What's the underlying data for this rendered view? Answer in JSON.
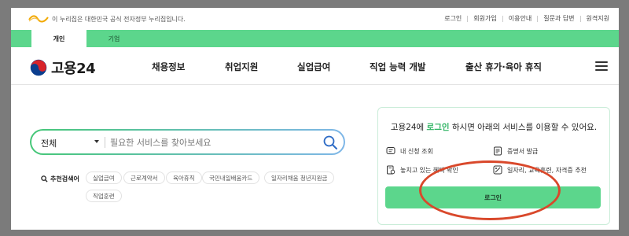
{
  "gov_banner": {
    "text": "이 누리집은 대한민국 공식 전자정부 누리집입니다.",
    "links": [
      "로그인",
      "회원가입",
      "이용안내",
      "질문과 답변",
      "원격지원"
    ]
  },
  "tabs": [
    {
      "label": "개인",
      "active": true
    },
    {
      "label": "기업",
      "active": false
    }
  ],
  "header": {
    "logo_text": "고용24",
    "nav": [
      "채용정보",
      "취업지원",
      "실업급여",
      "직업 능력 개발",
      "출산 휴가·육아 휴직"
    ]
  },
  "search": {
    "scope": "전체",
    "placeholder": "필요한 서비스를 찾아보세요",
    "keywords_label": "추천검색어",
    "keywords": [
      "실업급여",
      "근로계약서",
      "육아휴직",
      "국민내일배움카드",
      "일자리채움 청년지원금",
      "직업훈련"
    ]
  },
  "login_card": {
    "title_prefix": "고용24에 ",
    "title_highlight": "로그인",
    "title_suffix": " 하시면 아래의 서비스를 이용할 수 있어요.",
    "services": [
      "내 신청 조회",
      "증명서 발급",
      "놓치고 있는 혜택 확인",
      "일자리, 교육훈련, 자격증 추천"
    ],
    "button_label": "로그인"
  },
  "colors": {
    "brand_green": "#5cd68c",
    "highlight_green": "#2fb463",
    "annotation_red": "#d9482b"
  }
}
